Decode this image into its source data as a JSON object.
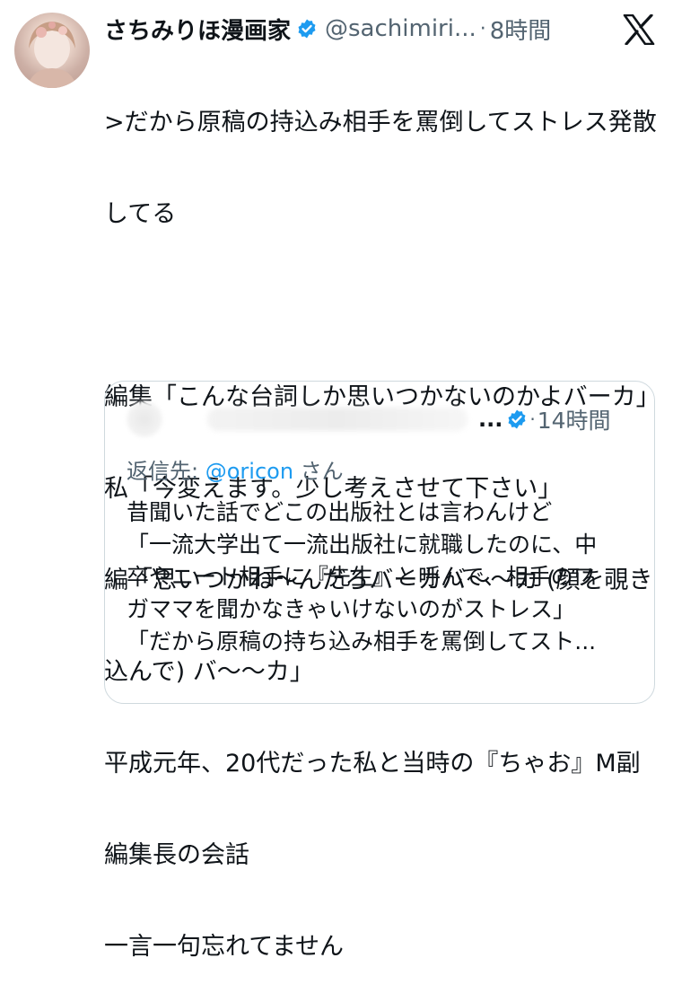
{
  "author": {
    "display_name": "さちみりほ漫画家",
    "handle": "@sachimiri...",
    "separator": "·",
    "time": "8時間",
    "verified_color": "#1d9bf0"
  },
  "logo": {
    "icon": "x-logo-icon"
  },
  "tweet": {
    "lines": [
      ">だから原稿の持込み相手を罵倒してストレス発散",
      "してる",
      "",
      "編集「こんな台詞しか思いつかないのかよバーカ」",
      "私「今変えます。少し考えさせて下さい」",
      "編「思いつかね〜んだろバーカバ〜〜カ (顔を覗き",
      "込んで) バ〜〜カ」",
      "平成元年、20代だった私と当時の『ちゃお』M副",
      "編集長の会話",
      "一言一句忘れてません"
    ]
  },
  "quote": {
    "ellipsis": "...",
    "separator": "·",
    "time": "14時間",
    "reply_prefix": "返信先: ",
    "reply_mention": "@oricon",
    "reply_suffix": "さん",
    "lines": [
      "昔聞いた話でどこの出版社とは言わんけど",
      "「一流大学出て一流出版社に就職したのに、中",
      "卒やニート相手に『先生』と呼んで、相手のワ",
      "ガママを聞かなきゃいけないのがストレス」",
      "「だから原稿の持ち込み相手を罵倒してスト..."
    ]
  }
}
